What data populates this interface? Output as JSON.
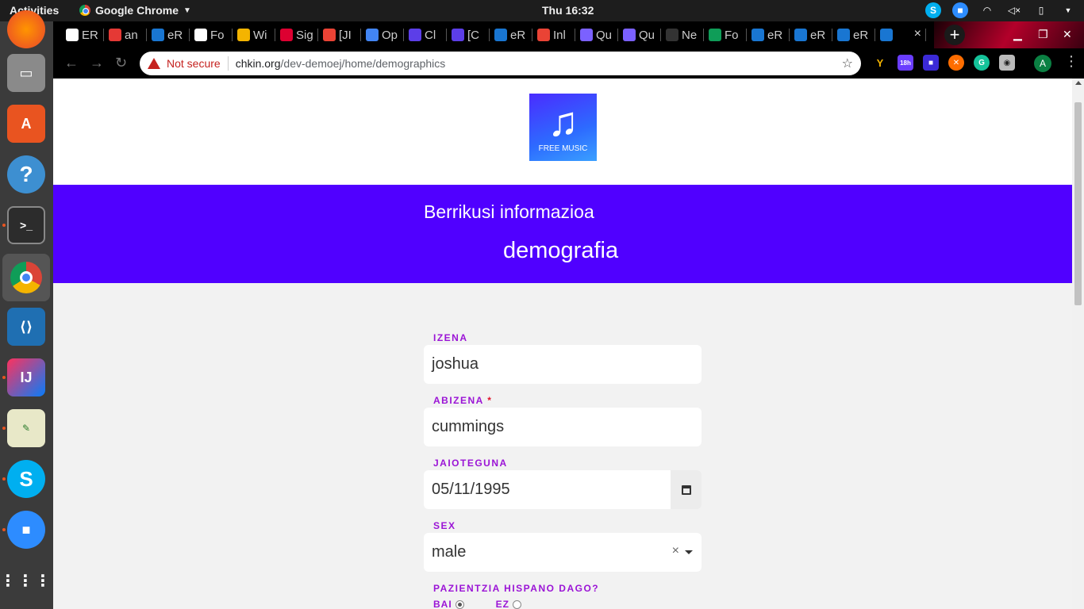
{
  "system": {
    "activities": "Activities",
    "app_name": "Google Chrome",
    "clock": "Thu 16:32"
  },
  "browser": {
    "tabs": [
      {
        "title": "ER",
        "favicon": "google-icon",
        "color": "#ffffff"
      },
      {
        "title": "an",
        "favicon": "n-icon",
        "color": "#e53935"
      },
      {
        "title": "eR",
        "favicon": "angular-icon",
        "color": "#1976d2"
      },
      {
        "title": "Fo",
        "favicon": "google-icon",
        "color": "#ffffff"
      },
      {
        "title": "Wi",
        "favicon": "pencil-icon",
        "color": "#f4b400"
      },
      {
        "title": "Sig",
        "favicon": "angular-red-icon",
        "color": "#dd0031"
      },
      {
        "title": "[JI",
        "favicon": "gmail-icon",
        "color": "#ea4335"
      },
      {
        "title": "Op",
        "favicon": "code-icon",
        "color": "#4285f4"
      },
      {
        "title": "Cl",
        "favicon": "diamond-icon",
        "color": "#5c3ee8"
      },
      {
        "title": "[C",
        "favicon": "diamond-icon",
        "color": "#5c3ee8"
      },
      {
        "title": "eR",
        "favicon": "angular-icon",
        "color": "#1976d2"
      },
      {
        "title": "Inl",
        "favicon": "gmail-icon",
        "color": "#ea4335"
      },
      {
        "title": "Qu",
        "favicon": "calendar-icon",
        "color": "#7b61ff"
      },
      {
        "title": "Qu",
        "favicon": "calendar-icon",
        "color": "#7b61ff"
      },
      {
        "title": "Ne",
        "favicon": "github-icon",
        "color": "#333333"
      },
      {
        "title": "Fo",
        "favicon": "code-icon",
        "color": "#0f9d58"
      },
      {
        "title": "eR",
        "favicon": "angular-icon",
        "color": "#1976d2"
      },
      {
        "title": "eR",
        "favicon": "angular-icon",
        "color": "#1976d2"
      },
      {
        "title": "eR",
        "favicon": "angular-icon",
        "color": "#1976d2"
      }
    ],
    "active_tab_close": "×",
    "new_tab": "+",
    "security_label": "Not secure",
    "url_host": "chkin.org",
    "url_path": "/dev-demoej/home/demographics",
    "profile_initial": "A",
    "ext_badge": "18h"
  },
  "page": {
    "logo_caption": "FREE MUSIC",
    "kicker": "Berrikusi informazioa",
    "title": "demografia",
    "fields": {
      "first_name": {
        "label": "IZENA",
        "value": "joshua"
      },
      "last_name": {
        "label": "ABIZENA",
        "required_mark": "*",
        "value": "cummings"
      },
      "birthdate": {
        "label": "JAIOTEGUNA",
        "value": "05/11/1995"
      },
      "sex": {
        "label": "SEX",
        "value": "male",
        "clear": "×"
      },
      "hispanic": {
        "label": "PAZIENTZIA HISPANO DAGO?",
        "yes": "BAI",
        "no": "EZ",
        "selected": "yes"
      }
    }
  },
  "colors": {
    "accent": "#5000ff",
    "label": "#9b14d6",
    "required": "#e0152b",
    "not_secure": "#c5221f"
  }
}
